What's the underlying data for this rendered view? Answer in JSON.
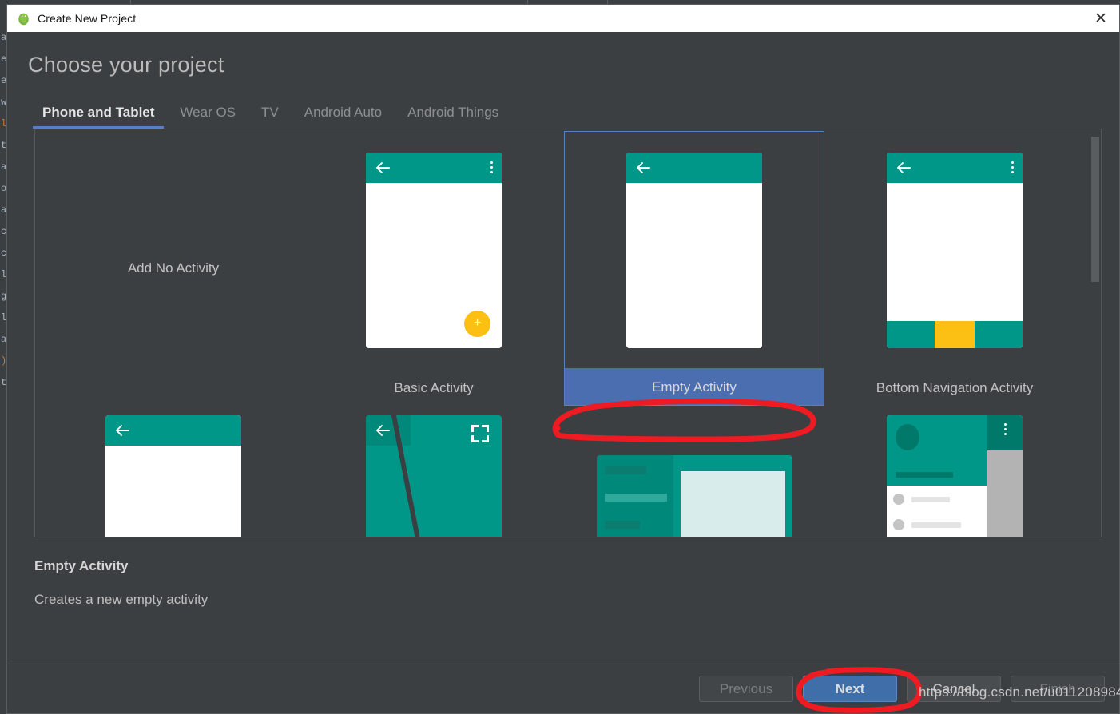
{
  "window": {
    "title": "Create New Project",
    "app_icon": "android-icon",
    "close_label": "✕"
  },
  "heading": "Choose your project",
  "tabs": [
    {
      "label": "Phone and Tablet",
      "active": true
    },
    {
      "label": "Wear OS",
      "active": false
    },
    {
      "label": "TV",
      "active": false
    },
    {
      "label": "Android Auto",
      "active": false
    },
    {
      "label": "Android Things",
      "active": false
    }
  ],
  "templates": {
    "row1": [
      {
        "label": "Add No Activity",
        "kind": "text-only"
      },
      {
        "label": "Basic Activity",
        "kind": "phone-fab",
        "selected": false
      },
      {
        "label": "Empty Activity",
        "kind": "phone-empty",
        "selected": true
      },
      {
        "label": "Bottom Navigation Activity",
        "kind": "phone-bottomnav",
        "selected": false
      }
    ],
    "row2": [
      {
        "label": "",
        "kind": "phone-plain"
      },
      {
        "label": "",
        "kind": "fullscreen"
      },
      {
        "label": "",
        "kind": "master-detail"
      },
      {
        "label": "",
        "kind": "nav-drawer"
      }
    ]
  },
  "description": {
    "title": "Empty Activity",
    "text": "Creates a new empty activity"
  },
  "buttons": {
    "previous": "Previous",
    "next": "Next",
    "cancel": "Cancel",
    "finish": "Finish"
  },
  "watermark": "https://blog.csdn.net/u011208984",
  "colors": {
    "dialog_bg": "#3c3f41",
    "accent_teal": "#009688",
    "accent_yellow": "#fcc014",
    "selection_blue": "#4b6eb0",
    "selection_border": "#5680c2",
    "primary_button": "#3f6ea8",
    "annotation_red": "#ee1c22"
  },
  "ide_background_lines": [
    "a",
    "e",
    "e",
    "w",
    "",
    "l.",
    "ti",
    "a",
    "o",
    "",
    "",
    "a",
    "c",
    "c",
    "l",
    "g",
    "l",
    "a",
    ")",
    "t"
  ]
}
